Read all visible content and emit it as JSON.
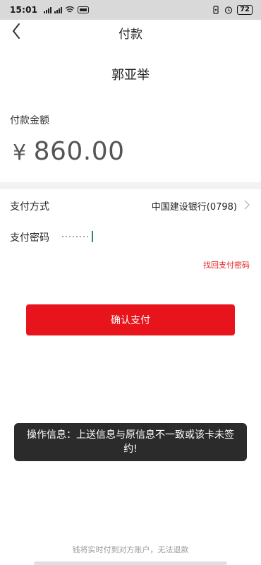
{
  "status_bar": {
    "time": "15:01",
    "battery": "72"
  },
  "header": {
    "title": "付款"
  },
  "payee": {
    "name": "郭亚举"
  },
  "amount": {
    "label": "付款金额",
    "currency": "¥",
    "value": "860.00"
  },
  "payment": {
    "method_label": "支付方式",
    "method_value": "中国建设银行(0798)",
    "password_label": "支付密码",
    "forgot_link": "找回支付密码"
  },
  "confirm_button": {
    "label": "确认支付"
  },
  "toast": {
    "message": "操作信息：上送信息与原信息不一致或该卡未签约!"
  },
  "footer": {
    "note": "钱将实时付到对方账户，无法退款"
  },
  "colors": {
    "accent": "#e8141c",
    "toast_bg": "#2b2b2b"
  },
  "icons": [
    "back-arrow-icon",
    "chevron-right-icon",
    "signal-icon",
    "wifi-icon",
    "alarm-icon",
    "battery-icon"
  ]
}
